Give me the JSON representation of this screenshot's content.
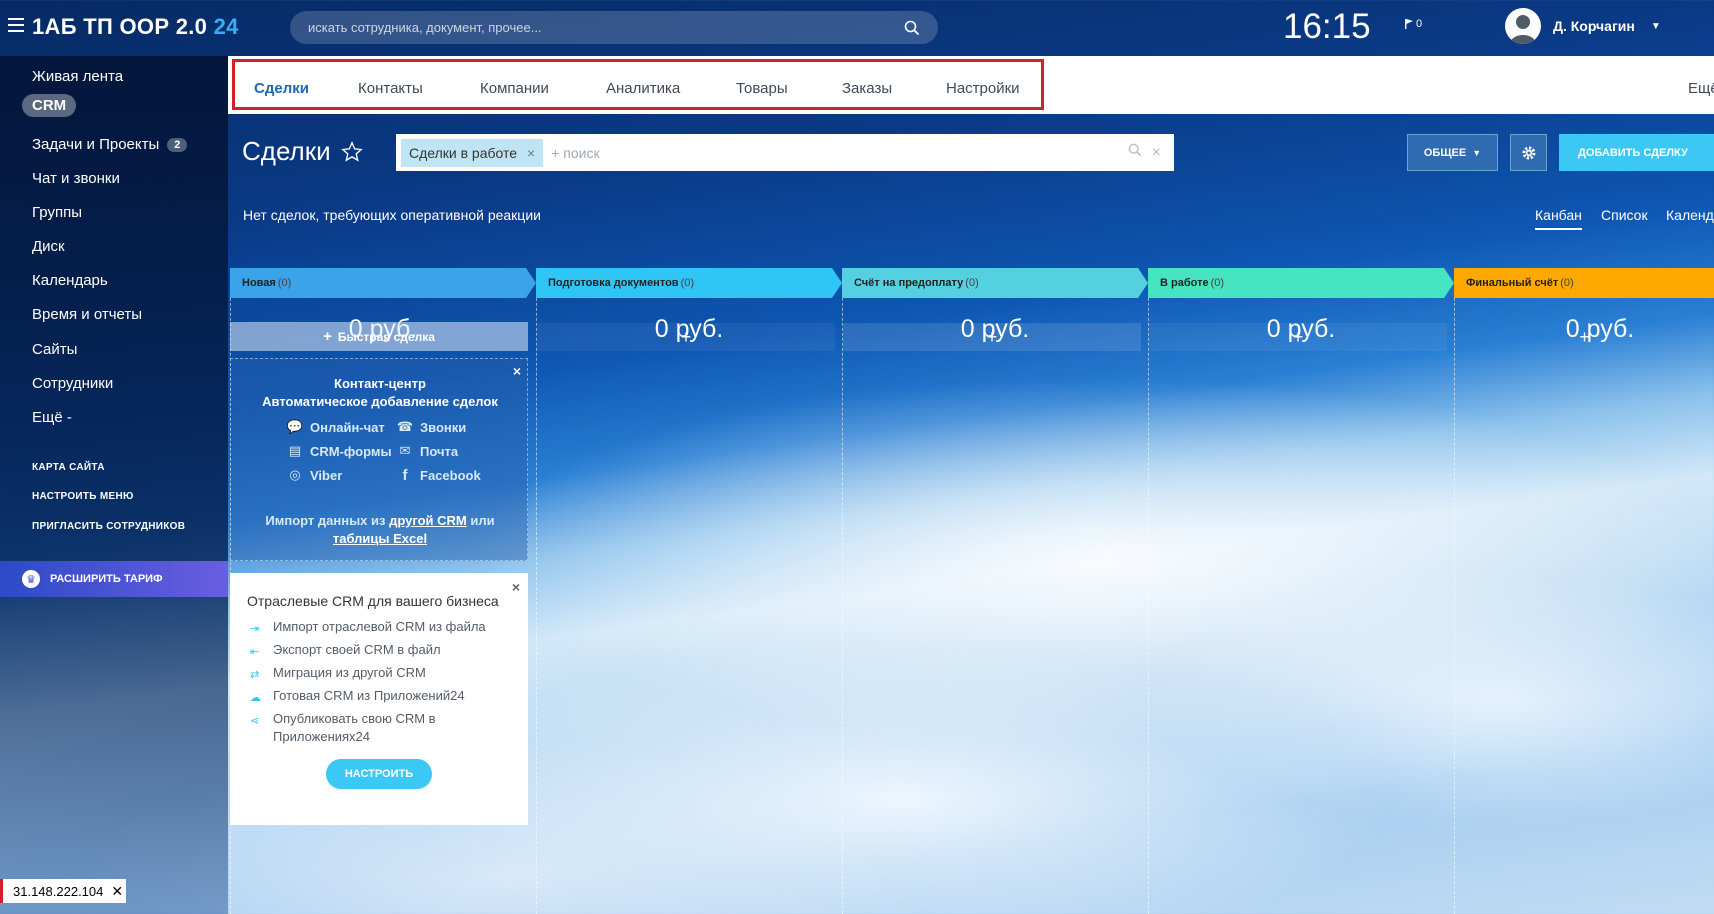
{
  "header": {
    "logo_main": "1АБ ТП ООР 2.0",
    "logo_num": "24",
    "search_placeholder": "искать сотрудника, документ, прочее...",
    "clock": "16:15",
    "flag_count": "0",
    "user_name": "Д. Корчагин"
  },
  "sidebar": {
    "items": [
      {
        "label": "Живая лента"
      },
      {
        "label": "CRM"
      },
      {
        "label": "Задачи и Проекты",
        "badge": "2"
      },
      {
        "label": "Чат и звонки"
      },
      {
        "label": "Группы"
      },
      {
        "label": "Диск"
      },
      {
        "label": "Календарь"
      },
      {
        "label": "Время и отчеты"
      },
      {
        "label": "Сайты"
      },
      {
        "label": "Сотрудники"
      },
      {
        "label": "Ещё -"
      }
    ],
    "small_links": [
      "КАРТА САЙТА",
      "НАСТРОИТЬ МЕНЮ",
      "ПРИГЛАСИТЬ СОТРУДНИКОВ"
    ],
    "tariff": "РАСШИРИТЬ ТАРИФ"
  },
  "crm_tabs": {
    "items": [
      "Сделки",
      "Контакты",
      "Компании",
      "Аналитика",
      "Товары",
      "Заказы",
      "Настройки"
    ],
    "more": "Ещё"
  },
  "page": {
    "title": "Сделки",
    "filter_tag": "Сделки в работе",
    "filter_placeholder": "+ поиск",
    "btn_general": "ОБЩЕЕ",
    "btn_add": "ДОБАВИТЬ СДЕЛКУ",
    "notice": "Нет сделок, требующих оперативной реакции",
    "views": [
      "Канбан",
      "Список",
      "Календарь"
    ]
  },
  "kanban": {
    "columns": [
      {
        "name": "Новая",
        "count": "(0)",
        "sum": "0 руб.",
        "color": "#3ba3e8"
      },
      {
        "name": "Подготовка документов",
        "count": "(0)",
        "sum": "0 руб.",
        "color": "#2fc6f6"
      },
      {
        "name": "Счёт на предоплату",
        "count": "(0)",
        "sum": "0 руб.",
        "color": "#55d0e0"
      },
      {
        "name": "В работе",
        "count": "(0)",
        "sum": "0 руб.",
        "color": "#47e4c2"
      },
      {
        "name": "Финальный счёт",
        "count": "(0)",
        "sum": "0 руб.",
        "color": "#ffa900"
      }
    ],
    "quick_deal": "Быстрая сделка",
    "add_symbol": "+"
  },
  "contact_center": {
    "title_line1": "Контакт-центр",
    "title_line2": "Автоматическое добавление сделок",
    "channels": [
      "Онлайн-чат",
      "Звонки",
      "CRM-формы",
      "Почта",
      "Viber",
      "Facebook"
    ],
    "import_text1": "Импорт данных из ",
    "import_link1": "другой CRM",
    "import_text2": " или",
    "import_link2": "таблицы Excel"
  },
  "industry": {
    "title": "Отраслевые CRM для вашего бизнеса",
    "items": [
      "Импорт отраслевой CRM из файла",
      "Экспорт своей CRM в файл",
      "Миграция из другой CRM",
      "Готовая CRM из Приложений24",
      "Опубликовать свою CRM в Приложениях24"
    ],
    "button": "НАСТРОИТЬ"
  },
  "ip_box": "31.148.222.104"
}
